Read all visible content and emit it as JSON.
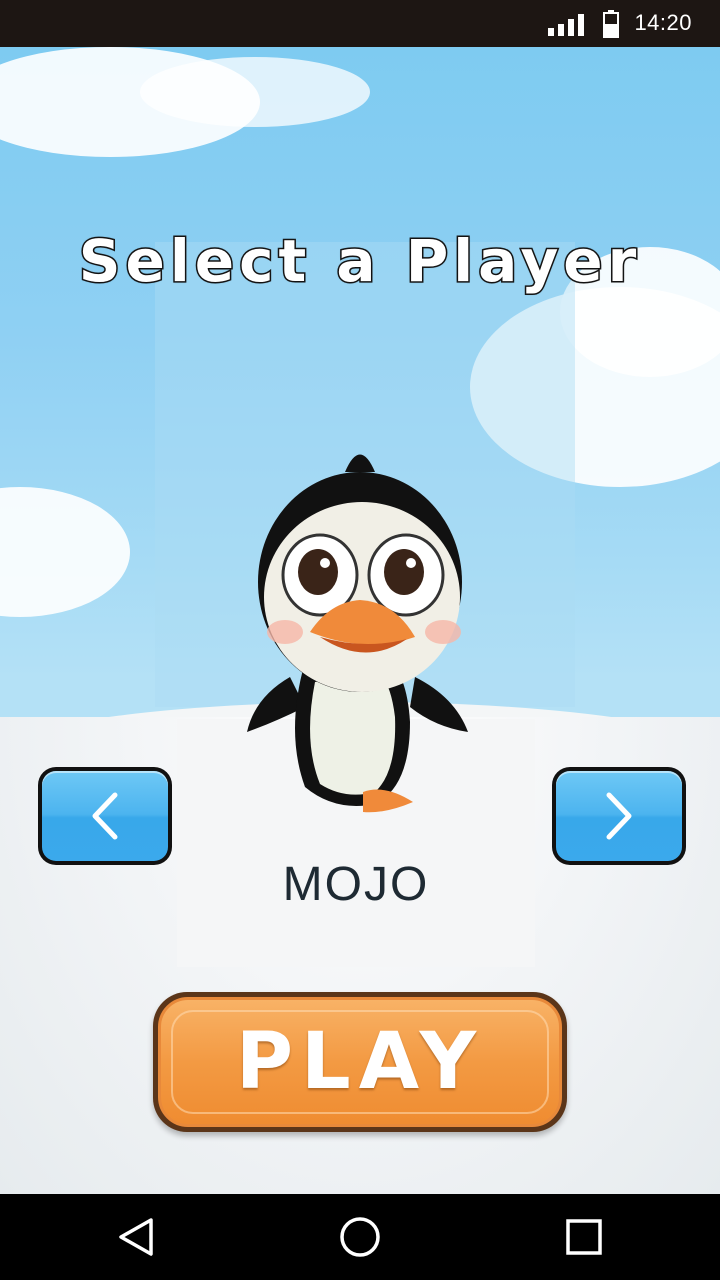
{
  "status_bar": {
    "time": "14:20",
    "icons": [
      "signal-icon",
      "battery-icon"
    ]
  },
  "screen": {
    "title": "Select a Player",
    "player_name": "MOJO",
    "prev_button": {
      "icon": "chevron-left-icon"
    },
    "next_button": {
      "icon": "chevron-right-icon"
    },
    "play_label": "PLAY"
  },
  "nav_bar": {
    "buttons": [
      "back-icon",
      "home-icon",
      "recents-icon"
    ]
  },
  "colors": {
    "sky": "#7ecbf1",
    "arrow_button": "#4cb4ef",
    "play_button": "#f39a43",
    "play_border": "#5b3519",
    "name_text": "#1e2a33"
  }
}
